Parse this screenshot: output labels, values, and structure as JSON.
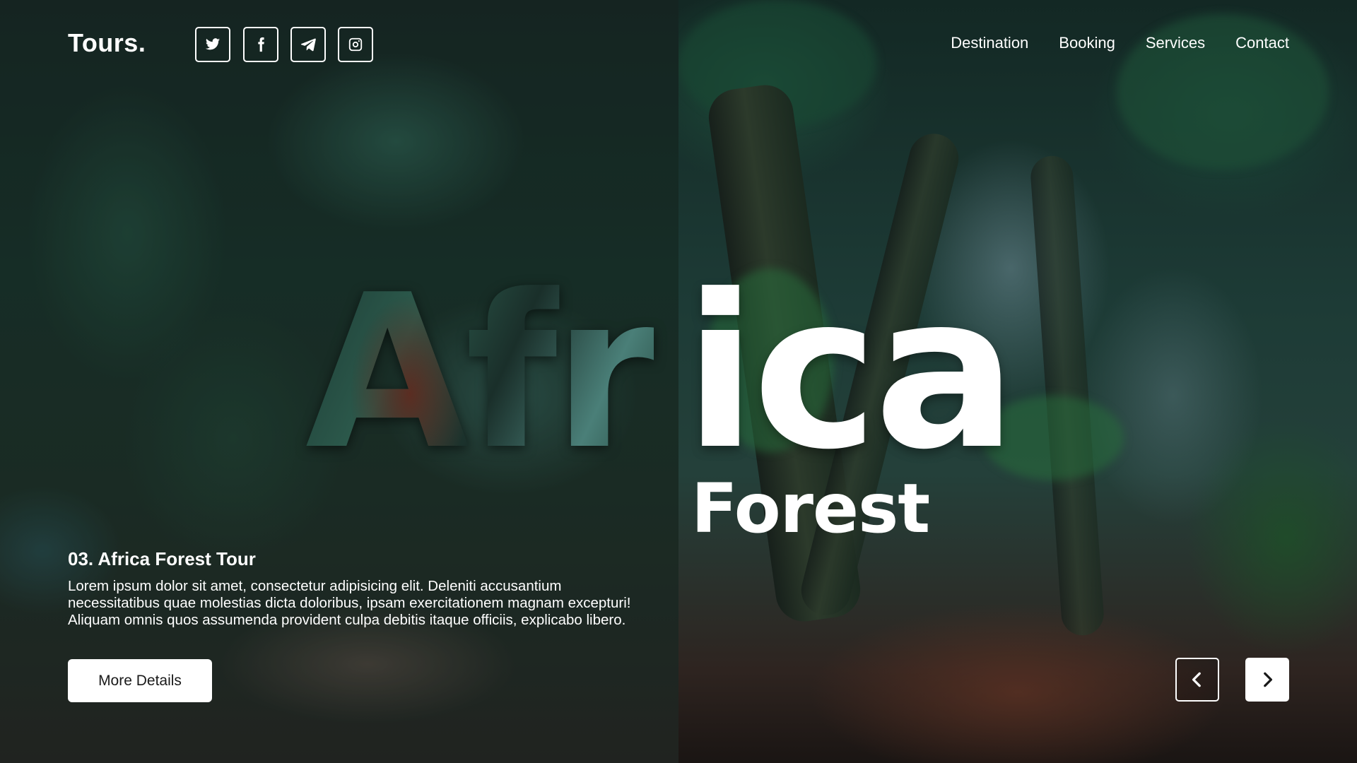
{
  "header": {
    "logo": "Tours.",
    "social": [
      {
        "name": "twitter-icon"
      },
      {
        "name": "facebook-icon"
      },
      {
        "name": "telegram-icon"
      },
      {
        "name": "instagram-icon"
      }
    ],
    "nav": [
      "Destination",
      "Booking",
      "Services",
      "Contact"
    ]
  },
  "hero": {
    "title_left": "Afr",
    "title_right": "ica",
    "subtitle": "Forest"
  },
  "info": {
    "heading": "03. Africa Forest Tour",
    "description": "Lorem ipsum dolor sit amet, consectetur adipisicing elit. Deleniti accusantium necessitatibus quae molestias dicta doloribus, ipsam exercitationem magnam excepturi! Aliquam omnis quos assumenda provident culpa debitis itaque officiis, explicabo libero.",
    "button_label": "More Details"
  },
  "slider": {
    "prev_icon": "chevron-left-icon",
    "next_icon": "chevron-right-icon"
  },
  "colors": {
    "text": "#ffffff",
    "button_bg": "#ffffff",
    "button_text": "#1a1a1a"
  }
}
